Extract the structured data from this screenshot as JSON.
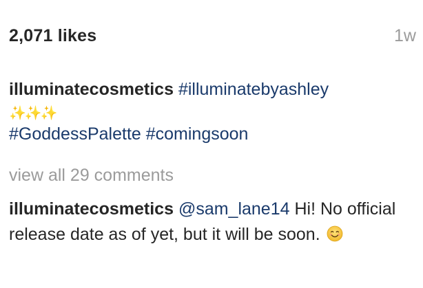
{
  "post": {
    "likes": "2,071 likes",
    "time_ago": "1w"
  },
  "caption": {
    "username": "illuminatecosmetics",
    "hashtag_1": "#illuminatebyashley",
    "sparkles": "✨✨✨",
    "hashtag_2": "#GoddessPalette",
    "hashtag_3": "#comingsoon"
  },
  "comments": {
    "view_all": "view all 29 comments",
    "items": [
      {
        "username": "illuminatecosmetics",
        "mention": "@sam_lane14",
        "text": " Hi! No official release date as of yet, but it will be soon. ",
        "emoji": "smiling-face-icon"
      }
    ]
  },
  "colors": {
    "text": "#262626",
    "link": "#1a3a6b",
    "muted": "#9b9b9b",
    "sparkle": "#f4c430",
    "emoji_face": "#f7c531"
  }
}
